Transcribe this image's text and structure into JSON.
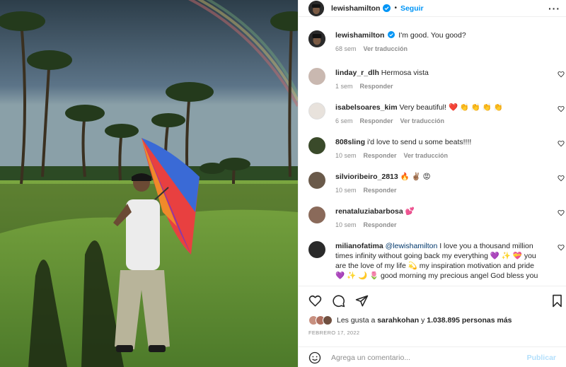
{
  "post": {
    "author": "lewishamilton",
    "follow_label": "Seguir",
    "more_label": "···",
    "caption": "I'm good. You good?",
    "caption_age": "68 sem",
    "translate_label": "Ver traducción",
    "reply_label": "Responder"
  },
  "comments": [
    {
      "user": "linday_r_dlh",
      "text": "Hermosa vista",
      "age": "1 sem",
      "translate": false,
      "avatar_color": "#c9b8b0"
    },
    {
      "user": "isabelsoares_kim",
      "text": "Very beautiful! ❤️ 👏 👏 👏 👏",
      "age": "6 sem",
      "translate": true,
      "avatar_color": "#e8e2dc"
    },
    {
      "user": "808sling",
      "text": "i'd love to send u some beats!!!!",
      "age": "10 sem",
      "translate": true,
      "avatar_color": "#3a4a2a"
    },
    {
      "user": "silvioribeiro_2813",
      "text": "🔥 ✌🏽 😡",
      "age": "10 sem",
      "translate": false,
      "avatar_color": "#6a5a4a"
    },
    {
      "user": "renataluziabarbosa",
      "text": "💕",
      "age": "10 sem",
      "translate": false,
      "avatar_color": "#8a6a5a"
    },
    {
      "user": "milianofatima",
      "mention": "@lewishamilton",
      "text": " I love you a thousand million times infinity without going back my everything 💜 ✨ 💝 you are the love of my life 💫 my inspiration motivation and pride 💜 ✨ 🌙 🌷 good morning my precious angel God bless you",
      "age": "",
      "translate": false,
      "avatar_color": "#2a2a2a"
    }
  ],
  "likes": {
    "prefix": "Les gusta a",
    "first_user": "sarahkohan",
    "connector": "y",
    "others": "1.038.895 personas más"
  },
  "date": "FEBRERO 17, 2022",
  "composer": {
    "placeholder": "Agrega un comentario...",
    "publish_label": "Publicar"
  },
  "colors": {
    "accent": "#0095f6",
    "text": "#262626",
    "muted": "#8e8e8e",
    "publish_disabled": "#b2dffc"
  }
}
